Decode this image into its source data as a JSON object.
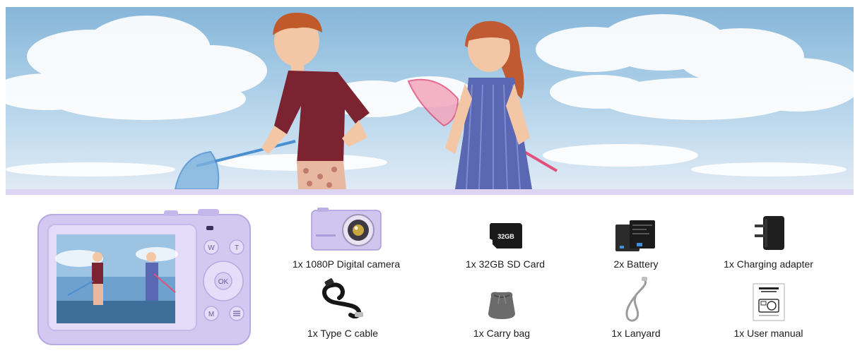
{
  "accent_color": "#cfc5ee",
  "banner": {
    "scene": "two-children-running-with-butterfly-nets-on-beach"
  },
  "camera_back": {
    "icon": "camera-back-icon",
    "buttons": [
      "W",
      "T",
      "OK",
      "M"
    ]
  },
  "items": [
    {
      "label": "1x 1080P Digital camera",
      "icon": "digital-camera-icon"
    },
    {
      "label": "1x 32GB SD Card",
      "icon": "sd-card-icon",
      "card_text": "32GB"
    },
    {
      "label": "2x Battery",
      "icon": "battery-icon"
    },
    {
      "label": "1x Charging adapter",
      "icon": "charging-adapter-icon"
    },
    {
      "label": "1x Type C cable",
      "icon": "type-c-cable-icon"
    },
    {
      "label": "1x Carry bag",
      "icon": "carry-bag-icon"
    },
    {
      "label": "1x Lanyard",
      "icon": "lanyard-icon"
    },
    {
      "label": "1x User manual",
      "icon": "user-manual-icon",
      "manual_title": "Digital Camera Instruction Manual"
    }
  ]
}
